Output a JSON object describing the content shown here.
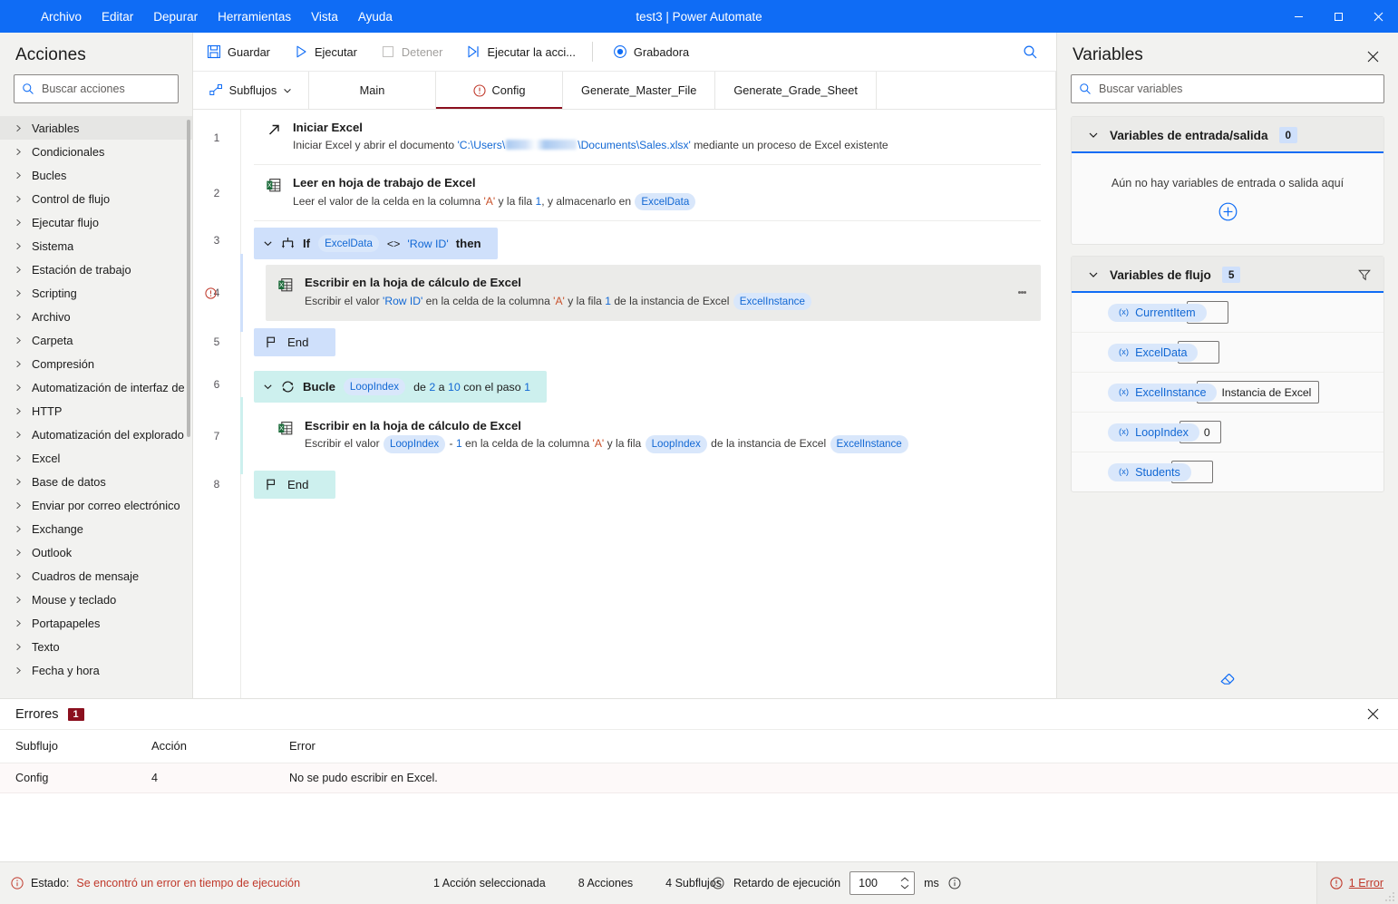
{
  "titlebar": {
    "title": "test3 | Power Automate",
    "menus": [
      "Archivo",
      "Editar",
      "Depurar",
      "Herramientas",
      "Vista",
      "Ayuda"
    ],
    "minimize": "─",
    "maximize": "☐",
    "close": "✕",
    "accent_color": "#0f6cf5"
  },
  "sidebar": {
    "title": "Acciones",
    "search_placeholder": "Buscar acciones",
    "items": [
      {
        "label": "Variables",
        "selected": true
      },
      {
        "label": "Condicionales",
        "selected": false
      },
      {
        "label": "Bucles",
        "selected": false
      },
      {
        "label": "Control de flujo",
        "selected": false
      },
      {
        "label": "Ejecutar flujo",
        "selected": false
      },
      {
        "label": "Sistema",
        "selected": false
      },
      {
        "label": "Estación de trabajo",
        "selected": false
      },
      {
        "label": "Scripting",
        "selected": false
      },
      {
        "label": "Archivo",
        "selected": false
      },
      {
        "label": "Carpeta",
        "selected": false
      },
      {
        "label": "Compresión",
        "selected": false
      },
      {
        "label": "Automatización de interfaz de",
        "selected": false
      },
      {
        "label": "HTTP",
        "selected": false
      },
      {
        "label": "Automatización del explorado",
        "selected": false
      },
      {
        "label": "Excel",
        "selected": false
      },
      {
        "label": "Base de datos",
        "selected": false
      },
      {
        "label": "Enviar por correo electrónico",
        "selected": false
      },
      {
        "label": "Exchange",
        "selected": false
      },
      {
        "label": "Outlook",
        "selected": false
      },
      {
        "label": "Cuadros de mensaje",
        "selected": false
      },
      {
        "label": "Mouse y teclado",
        "selected": false
      },
      {
        "label": "Portapapeles",
        "selected": false
      },
      {
        "label": "Texto",
        "selected": false
      },
      {
        "label": "Fecha y hora",
        "selected": false
      }
    ]
  },
  "toolbar": {
    "save": "Guardar",
    "run": "Ejecutar",
    "stop": "Detener",
    "run_action": "Ejecutar la acci...",
    "recorder": "Grabadora"
  },
  "tabs": {
    "subflows": "Subflujos",
    "items": [
      {
        "label": "Main",
        "active": false,
        "error": false
      },
      {
        "label": "Config",
        "active": true,
        "error": true
      },
      {
        "label": "Generate_Master_File",
        "active": false,
        "error": false
      },
      {
        "label": "Generate_Grade_Sheet",
        "active": false,
        "error": false
      }
    ]
  },
  "flow": {
    "steps": [
      {
        "num": "1",
        "kind": "action",
        "title": "Iniciar Excel",
        "desc_prefix": "Iniciar Excel y abrir el documento ",
        "path_start": "'C:\\Users\\",
        "path_end": "\\Documents\\Sales.xlsx'",
        "desc_suffix": " mediante un proceso de Excel existente",
        "icon": "launch-excel-icon",
        "error": false,
        "selected": false
      },
      {
        "num": "2",
        "kind": "action",
        "title": "Leer en hoja de trabajo de Excel",
        "desc_a": "Leer el valor de la celda en la columna ",
        "col": "'A'",
        "desc_b": " y la fila ",
        "row": "1",
        "desc_c": ", y almacenarlo en ",
        "var": "ExcelData",
        "icon": "excel-icon",
        "error": false,
        "selected": false
      },
      {
        "num": "3",
        "kind": "if-head",
        "kw": "If",
        "var": "ExcelData",
        "op": "<>",
        "value": "'Row ID'",
        "then": "then"
      },
      {
        "num": "4",
        "kind": "action-nested-if",
        "title": "Escribir en la hoja de cálculo de Excel",
        "desc_a": "Escribir el valor ",
        "value": "'Row ID'",
        "desc_b": " en la celda de la columna ",
        "col": "'A'",
        "desc_c": " y la fila ",
        "row": "1",
        "desc_d": " de la instancia de Excel ",
        "instance": "ExcelInstance",
        "icon": "excel-icon",
        "error": true,
        "selected": true
      },
      {
        "num": "5",
        "kind": "if-end",
        "label": "End"
      },
      {
        "num": "6",
        "kind": "loop-head",
        "kw": "Bucle",
        "var": "LoopIndex",
        "from_label": "de ",
        "from": "2",
        "to_label": " a ",
        "to": "10",
        "step_label": " con el paso ",
        "step": "1"
      },
      {
        "num": "7",
        "kind": "action-nested-loop",
        "title": "Escribir en la hoja de cálculo de Excel",
        "desc_a": "Escribir el valor ",
        "var1": "LoopIndex",
        "desc_b": " - ",
        "one": "1",
        "desc_c": " en la celda de la columna ",
        "col": "'A'",
        "desc_d": " y la fila ",
        "var2": "LoopIndex",
        "desc_e": " de la instancia de Excel ",
        "instance": "ExcelInstance",
        "icon": "excel-icon",
        "error": false,
        "selected": false
      },
      {
        "num": "8",
        "kind": "loop-end",
        "label": "End"
      }
    ]
  },
  "variables": {
    "title": "Variables",
    "search_placeholder": "Buscar variables",
    "io_section": {
      "title": "Variables de entrada/salida",
      "count": "0",
      "empty_text": "Aún no hay variables de entrada o salida aquí"
    },
    "flow_section": {
      "title": "Variables de flujo",
      "count": "5",
      "rows": [
        {
          "name": "CurrentItem",
          "value": "",
          "sym": "(x)"
        },
        {
          "name": "ExcelData",
          "value": "",
          "sym": "(x)"
        },
        {
          "name": "ExcelInstance",
          "value": "Instancia de Excel",
          "sym": "(x)"
        },
        {
          "name": "LoopIndex",
          "value": "0",
          "sym": "(x)"
        },
        {
          "name": "Students",
          "value": "",
          "sym": "(x)"
        }
      ]
    }
  },
  "errors_panel": {
    "title": "Errores",
    "count": "1",
    "columns": [
      "Subflujo",
      "Acción",
      "Error"
    ],
    "rows": [
      {
        "subflow": "Config",
        "action": "4",
        "error": "No se pudo escribir en Excel."
      }
    ]
  },
  "statusbar": {
    "state_label": "Estado:",
    "state_value": "Se encontró un error en tiempo de ejecución",
    "selected_actions": "1 Acción seleccionada",
    "actions_count": "8 Acciones",
    "subflows_count": "4 Subflujos",
    "delay_label": "Retardo de ejecución",
    "delay_value": "100",
    "delay_unit": "ms",
    "error_link": "1 Error"
  }
}
